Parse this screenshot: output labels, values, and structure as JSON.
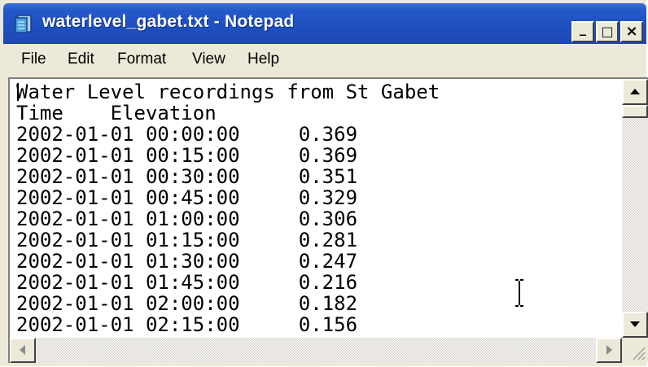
{
  "window": {
    "title": "waterlevel_gabet.txt - Notepad",
    "controls": {
      "minimize_glyph": "_",
      "maximize_glyph": "□",
      "close_glyph": "×"
    }
  },
  "menu": {
    "items": [
      "File",
      "Edit",
      "Format",
      "View",
      "Help"
    ]
  },
  "document": {
    "lines": [
      "Water Level recordings from St Gabet",
      "Time    Elevation",
      "2002-01-01 00:00:00     0.369",
      "2002-01-01 00:15:00     0.369",
      "2002-01-01 00:30:00     0.351",
      "2002-01-01 00:45:00     0.329",
      "2002-01-01 01:00:00     0.306",
      "2002-01-01 01:15:00     0.281",
      "2002-01-01 01:30:00     0.247",
      "2002-01-01 01:45:00     0.216",
      "2002-01-01 02:00:00     0.182",
      "2002-01-01 02:15:00     0.156"
    ]
  },
  "colors": {
    "titlebar": "#2458c9",
    "chrome": "#ece9d8",
    "text": "#000000"
  }
}
